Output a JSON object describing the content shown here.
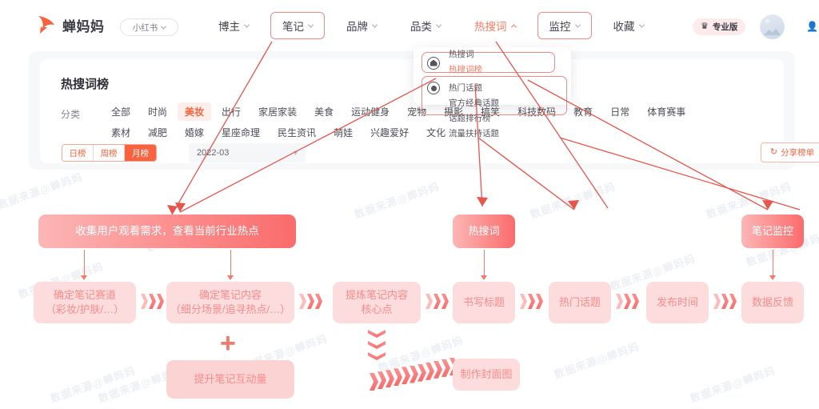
{
  "header": {
    "brand": "蝉妈妈",
    "platform_selector": {
      "value": "小红书",
      "icon": "chevron-down-icon"
    },
    "nav": [
      {
        "label": "博主",
        "state": "normal",
        "highlight": false
      },
      {
        "label": "笔记",
        "state": "normal",
        "highlight": true
      },
      {
        "label": "品牌",
        "state": "normal",
        "highlight": false
      },
      {
        "label": "品类",
        "state": "normal",
        "highlight": false
      },
      {
        "label": "热搜词",
        "state": "active",
        "highlight": false
      },
      {
        "label": "监控",
        "state": "normal",
        "highlight": true
      },
      {
        "label": "收藏",
        "state": "normal",
        "highlight": false
      }
    ],
    "pro_badge": {
      "label": "专业版",
      "icon": "crown-icon"
    },
    "avatar": "user-avatar",
    "side_icon": "person-icon"
  },
  "dropdown": {
    "groups": [
      {
        "icon": "home-icon",
        "links": [
          {
            "label": "热搜词",
            "selected": false
          },
          {
            "label": "热搜词榜",
            "selected": true
          }
        ]
      },
      {
        "icon": "radio-dot-icon",
        "links": [
          {
            "label": "热门话题",
            "selected": false
          },
          {
            "label": "官方经典话题",
            "selected": false
          },
          {
            "label": "话题排行榜",
            "selected": false
          },
          {
            "label": "流量扶持话题",
            "selected": false
          }
        ]
      }
    ]
  },
  "card": {
    "title": "热搜词榜",
    "filter_label": "分类",
    "categories_row1": [
      "全部",
      "时尚",
      "美妆",
      "出行",
      "家居家装",
      "美食",
      "运动健身",
      "宠物",
      "摄影",
      "搞笑",
      "科技数码",
      "教育",
      "日常",
      "体育赛事"
    ],
    "categories_row2": [
      "素材",
      "减肥",
      "婚嫁",
      "星座命理",
      "民生资讯",
      "萌娃",
      "兴趣爱好",
      "文化"
    ],
    "selected_category": "美妆",
    "period_tabs": [
      {
        "label": "日榜",
        "selected": false
      },
      {
        "label": "周榜",
        "selected": false
      },
      {
        "label": "月榜",
        "selected": true
      }
    ],
    "date_value": "2022-03",
    "date_icon": "calendar-icon",
    "share_button": {
      "label": "分享榜单",
      "icon": "refresh-icon"
    }
  },
  "flow": {
    "banner": "收集用户观看需求，查看当前行业热点",
    "source_hot_word": "热搜词",
    "source_note_monitor": "笔记监控",
    "steps": [
      {
        "line1": "确定笔记赛道",
        "line2": "（彩妆/护肤/…）"
      },
      {
        "line1": "确定笔记内容",
        "line2": "（细分场景/追寻热点/…）"
      },
      {
        "line1": "提炼笔记内容",
        "line2": "核心点"
      },
      {
        "line1": "书写标题",
        "line2": ""
      },
      {
        "line1": "热门话题",
        "line2": ""
      },
      {
        "line1": "发布时间",
        "line2": ""
      },
      {
        "line1": "数据反馈",
        "line2": ""
      }
    ],
    "plus_symbol": "+",
    "sub_engagement": "提升笔记互动量",
    "sub_cover": "制作封面图"
  },
  "watermark": {
    "text": "数据来源@蝉妈妈"
  },
  "colors": {
    "accent": "#f7633f",
    "annotation": "#e8554d",
    "flow_strong_from": "#fcb6b6",
    "flow_strong_to": "#fb6b6b",
    "flow_soft_bg": "#fcdcdc",
    "flow_soft_text": "#f98c8c"
  }
}
